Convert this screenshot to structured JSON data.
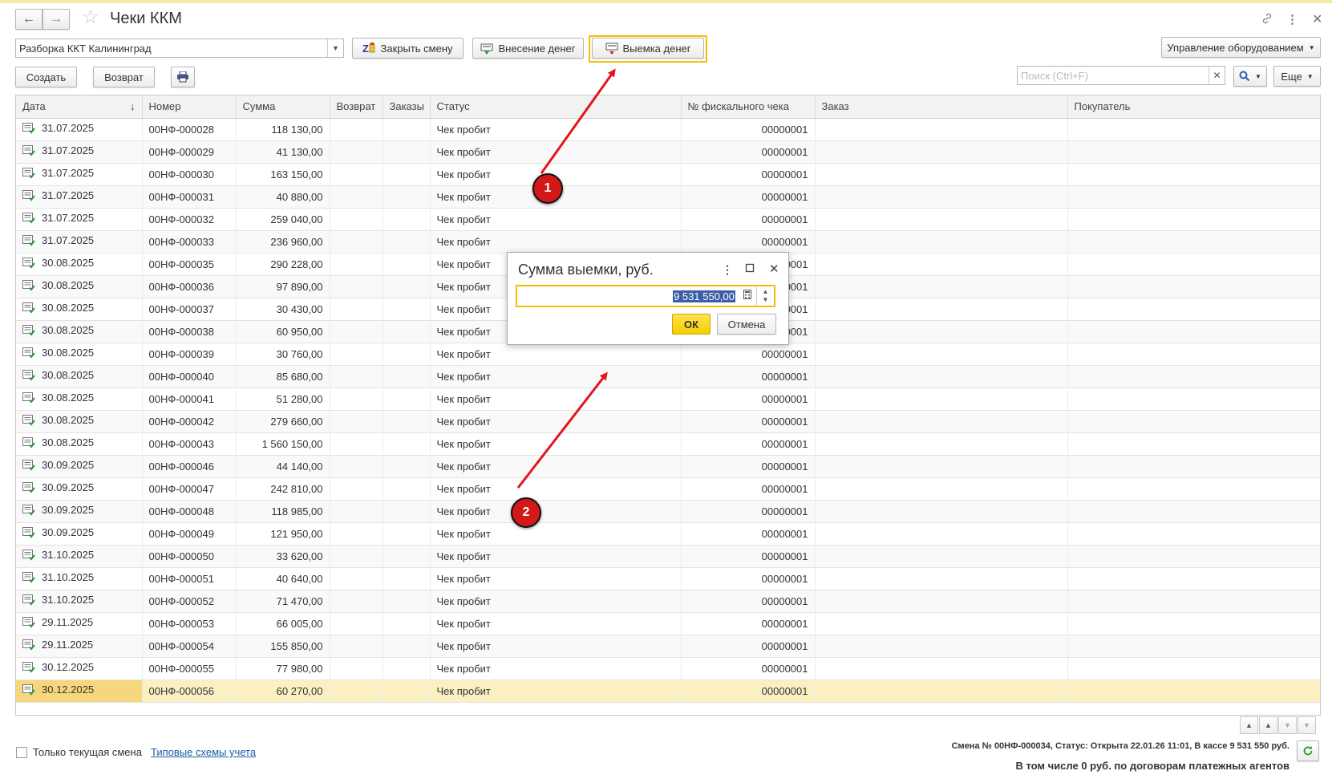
{
  "window": {
    "title": "Чеки ККМ"
  },
  "toolbar1": {
    "kkt_select": "Разборка ККТ Калининград",
    "close_shift": "Закрыть смену",
    "deposit": "Внесение денег",
    "withdraw": "Выемка денег",
    "equipment": "Управление оборудованием"
  },
  "toolbar2": {
    "create": "Создать",
    "return": "Возврат",
    "search_placeholder": "Поиск (Ctrl+F)",
    "more": "Еще"
  },
  "table": {
    "columns": [
      "Дата",
      "Номер",
      "Сумма",
      "Возврат",
      "Заказы",
      "Статус",
      "№ фискального чека",
      "Заказ",
      "Покупатель"
    ],
    "rows": [
      [
        "31.07.2025",
        "00НФ-000028",
        "118 130,00",
        "",
        "",
        "Чек пробит",
        "00000001",
        "",
        ""
      ],
      [
        "31.07.2025",
        "00НФ-000029",
        "41 130,00",
        "",
        "",
        "Чек пробит",
        "00000001",
        "",
        ""
      ],
      [
        "31.07.2025",
        "00НФ-000030",
        "163 150,00",
        "",
        "",
        "Чек пробит",
        "00000001",
        "",
        ""
      ],
      [
        "31.07.2025",
        "00НФ-000031",
        "40 880,00",
        "",
        "",
        "Чек пробит",
        "00000001",
        "",
        ""
      ],
      [
        "31.07.2025",
        "00НФ-000032",
        "259 040,00",
        "",
        "",
        "Чек пробит",
        "00000001",
        "",
        ""
      ],
      [
        "31.07.2025",
        "00НФ-000033",
        "236 960,00",
        "",
        "",
        "Чек пробит",
        "00000001",
        "",
        ""
      ],
      [
        "30.08.2025",
        "00НФ-000035",
        "290 228,00",
        "",
        "",
        "Чек пробит",
        "00000001",
        "",
        ""
      ],
      [
        "30.08.2025",
        "00НФ-000036",
        "97 890,00",
        "",
        "",
        "Чек пробит",
        "00000001",
        "",
        ""
      ],
      [
        "30.08.2025",
        "00НФ-000037",
        "30 430,00",
        "",
        "",
        "Чек пробит",
        "00000001",
        "",
        ""
      ],
      [
        "30.08.2025",
        "00НФ-000038",
        "60 950,00",
        "",
        "",
        "Чек пробит",
        "00000001",
        "",
        ""
      ],
      [
        "30.08.2025",
        "00НФ-000039",
        "30 760,00",
        "",
        "",
        "Чек пробит",
        "00000001",
        "",
        ""
      ],
      [
        "30.08.2025",
        "00НФ-000040",
        "85 680,00",
        "",
        "",
        "Чек пробит",
        "00000001",
        "",
        ""
      ],
      [
        "30.08.2025",
        "00НФ-000041",
        "51 280,00",
        "",
        "",
        "Чек пробит",
        "00000001",
        "",
        ""
      ],
      [
        "30.08.2025",
        "00НФ-000042",
        "279 660,00",
        "",
        "",
        "Чек пробит",
        "00000001",
        "",
        ""
      ],
      [
        "30.08.2025",
        "00НФ-000043",
        "1 560 150,00",
        "",
        "",
        "Чек пробит",
        "00000001",
        "",
        ""
      ],
      [
        "30.09.2025",
        "00НФ-000046",
        "44 140,00",
        "",
        "",
        "Чек пробит",
        "00000001",
        "",
        ""
      ],
      [
        "30.09.2025",
        "00НФ-000047",
        "242 810,00",
        "",
        "",
        "Чек пробит",
        "00000001",
        "",
        ""
      ],
      [
        "30.09.2025",
        "00НФ-000048",
        "118 985,00",
        "",
        "",
        "Чек пробит",
        "00000001",
        "",
        ""
      ],
      [
        "30.09.2025",
        "00НФ-000049",
        "121 950,00",
        "",
        "",
        "Чек пробит",
        "00000001",
        "",
        ""
      ],
      [
        "31.10.2025",
        "00НФ-000050",
        "33 620,00",
        "",
        "",
        "Чек пробит",
        "00000001",
        "",
        ""
      ],
      [
        "31.10.2025",
        "00НФ-000051",
        "40 640,00",
        "",
        "",
        "Чек пробит",
        "00000001",
        "",
        ""
      ],
      [
        "31.10.2025",
        "00НФ-000052",
        "71 470,00",
        "",
        "",
        "Чек пробит",
        "00000001",
        "",
        ""
      ],
      [
        "29.11.2025",
        "00НФ-000053",
        "66 005,00",
        "",
        "",
        "Чек пробит",
        "00000001",
        "",
        ""
      ],
      [
        "29.11.2025",
        "00НФ-000054",
        "155 850,00",
        "",
        "",
        "Чек пробит",
        "00000001",
        "",
        ""
      ],
      [
        "30.12.2025",
        "00НФ-000055",
        "77 980,00",
        "",
        "",
        "Чек пробит",
        "00000001",
        "",
        ""
      ],
      [
        "30.12.2025",
        "00НФ-000056",
        "60 270,00",
        "",
        "",
        "Чек пробит",
        "00000001",
        "",
        ""
      ]
    ],
    "selected_row": 25
  },
  "dialog": {
    "title": "Сумма выемки, руб.",
    "value": "9 531 550,00",
    "ok": "ОК",
    "cancel": "Отмена"
  },
  "annotations": {
    "badge1": "1",
    "badge2": "2",
    "color": "#e3141b"
  },
  "footer": {
    "only_current_shift": "Только текущая смена",
    "only_current_shift_checked": false,
    "link": "Типовые схемы учета",
    "status_line1": "Смена № 00НФ-000034, Статус: Открыта 22.01.26 11:01, В кассе 9 531 550 руб.",
    "status_line2": "В том числе 0 руб. по договорам платежных агентов"
  },
  "colors": {
    "accent": "#f0c000",
    "selected_row": "#fbf0c2",
    "link": "#1a5aa6"
  }
}
